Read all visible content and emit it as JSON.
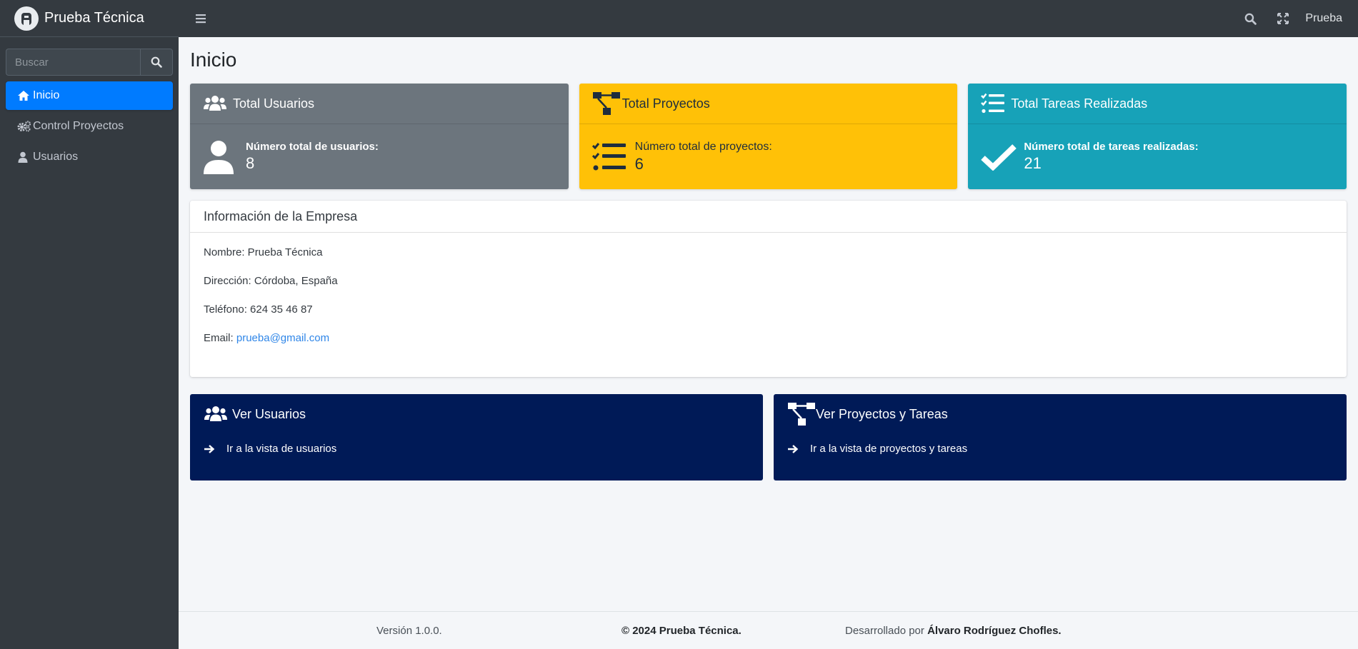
{
  "brand": {
    "name": "Prueba Técnica",
    "logo_icon": "logo-icon"
  },
  "search": {
    "placeholder": "Buscar"
  },
  "sidebar": {
    "items": [
      {
        "label": "Inicio",
        "icon": "home-icon",
        "active": true
      },
      {
        "label": "Control Proyectos",
        "icon": "gears-icon",
        "active": false
      },
      {
        "label": "Usuarios",
        "icon": "user-icon",
        "active": false
      }
    ]
  },
  "topbar": {
    "user": "Prueba"
  },
  "page": {
    "title": "Inicio"
  },
  "stats": [
    {
      "title": "Total Usuarios",
      "label": "Número total de usuarios:",
      "value": "8",
      "color": "#6c757d"
    },
    {
      "title": "Total Proyectos",
      "label": "Número total de proyectos:",
      "value": "6",
      "color": "#ffc107"
    },
    {
      "title": "Total Tareas Realizadas",
      "label": "Número total de tareas realizadas:",
      "value": "21",
      "color": "#17a2b8"
    }
  ],
  "company": {
    "header": "Información de la Empresa",
    "name": "Nombre: Prueba Técnica",
    "address": "Dirección: Córdoba, España",
    "phone": "Teléfono: 624 35 46 87",
    "email_label": "Email:",
    "email": "prueba@gmail.com"
  },
  "links": [
    {
      "title": "Ver Usuarios",
      "action": "Ir a la vista de usuarios"
    },
    {
      "title": "Ver Proyectos y Tareas",
      "action": "Ir a la vista de proyectos y tareas"
    }
  ],
  "footer": {
    "version": "Versión 1.0.0.",
    "copyright": "© 2024 Prueba Técnica.",
    "dev_prefix": "Desarrollado por",
    "dev_name": "Álvaro Rodríguez Chofles."
  },
  "colors": {
    "sidebar": "#343a40",
    "active": "#007bff",
    "link_card": "#001a57",
    "background": "#f4f6f9"
  }
}
